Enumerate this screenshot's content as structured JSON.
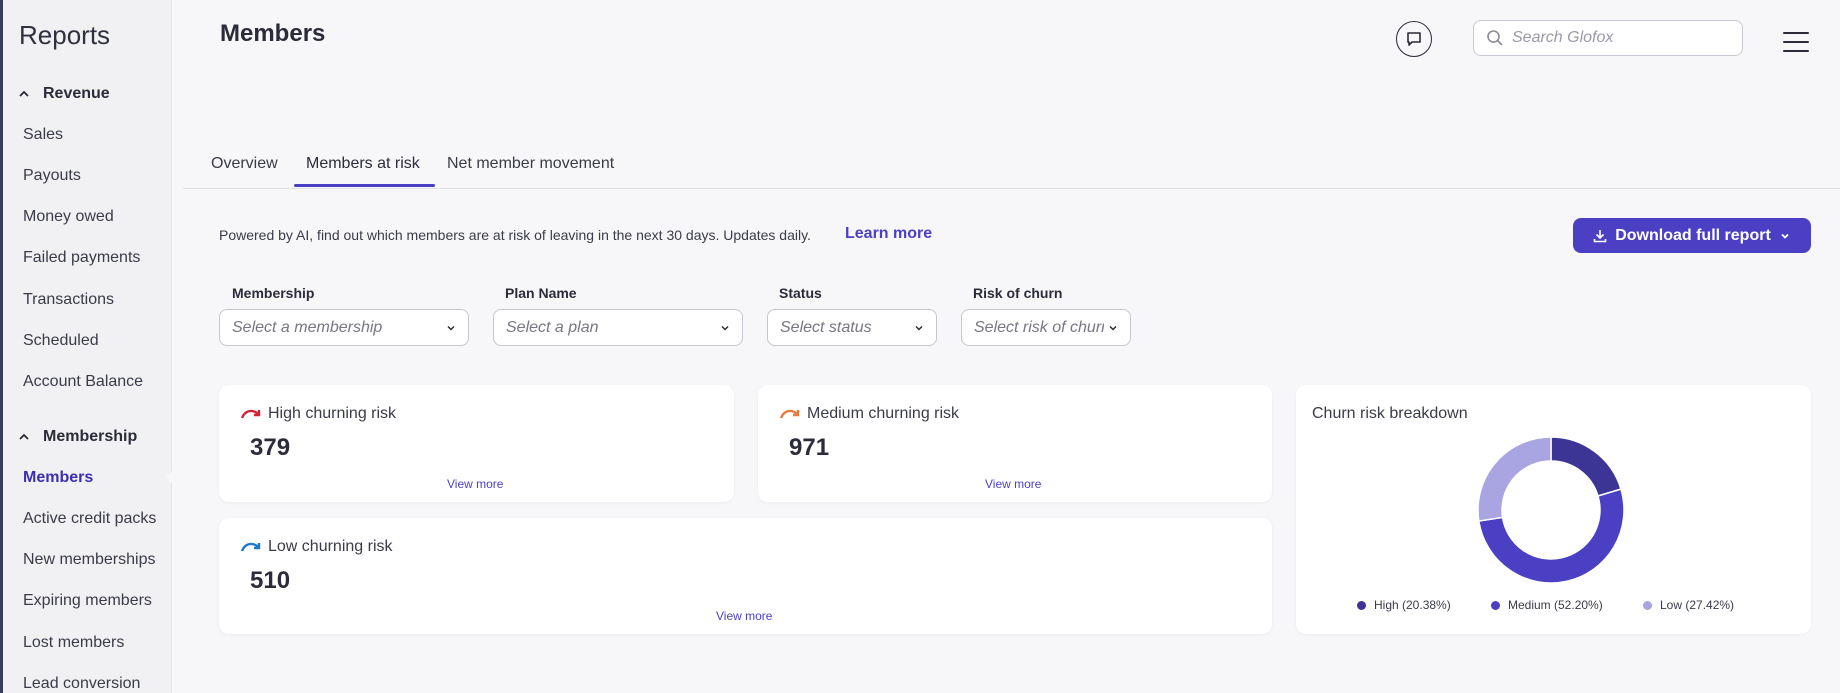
{
  "sidebar": {
    "title": "Reports",
    "sections": [
      {
        "label": "Revenue",
        "items": [
          "Sales",
          "Payouts",
          "Money owed",
          "Failed payments",
          "Transactions",
          "Scheduled",
          "Account Balance"
        ]
      },
      {
        "label": "Membership",
        "items": [
          "Members",
          "Active credit packs",
          "New memberships",
          "Expiring members",
          "Lost members",
          "Lead conversion"
        ]
      }
    ],
    "active_item": "Members"
  },
  "header": {
    "title": "Members",
    "search_placeholder": "Search Glofox"
  },
  "tabs": [
    {
      "label": "Overview",
      "active": false
    },
    {
      "label": "Members at risk",
      "active": true
    },
    {
      "label": "Net member movement",
      "active": false
    }
  ],
  "intro": {
    "text": "Powered by AI, find out which members are at risk of leaving in the next 30 days. Updates daily.",
    "learn_more": "Learn more",
    "download_label": "Download full report"
  },
  "filters": [
    {
      "label": "Membership",
      "placeholder": "Select a membership"
    },
    {
      "label": "Plan Name",
      "placeholder": "Select a plan"
    },
    {
      "label": "Status",
      "placeholder": "Select status"
    },
    {
      "label": "Risk of churn",
      "placeholder": "Select risk of churn"
    }
  ],
  "cards": {
    "high": {
      "title": "High churning risk",
      "value": "379",
      "link": "View more",
      "icon_color": "#d0243a"
    },
    "medium": {
      "title": "Medium churning risk",
      "value": "971",
      "link": "View more",
      "icon_color": "#e57a3d"
    },
    "low": {
      "title": "Low churning risk",
      "value": "510",
      "link": "View more",
      "icon_color": "#1d78c9"
    }
  },
  "breakdown": {
    "title": "Churn risk breakdown",
    "legend": [
      {
        "label": "High (20.38%)",
        "color": "#3d3596"
      },
      {
        "label": "Medium (52.20%)",
        "color": "#4b3fc4"
      },
      {
        "label": "Low (27.42%)",
        "color": "#a9a4e2"
      }
    ]
  },
  "chart_data": {
    "type": "pie",
    "title": "Churn risk breakdown",
    "categories": [
      "High",
      "Medium",
      "Low"
    ],
    "values": [
      20.38,
      52.2,
      27.42
    ],
    "colors": [
      "#3d3596",
      "#4b3fc4",
      "#a9a4e2"
    ],
    "legend_position": "bottom"
  }
}
